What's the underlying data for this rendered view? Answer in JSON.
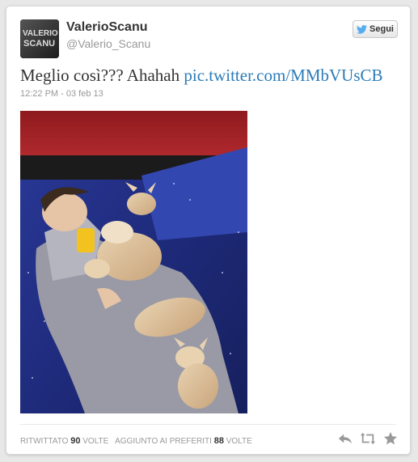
{
  "tweet": {
    "author_name": "ValerioScanu",
    "author_handle": "@Valerio_Scanu",
    "avatar_text_top": "VALERIO",
    "avatar_text_bottom": "SCANU",
    "text": "Meglio così??? Ahahah ",
    "link_text": "pic.twitter.com/MMbVUsCB",
    "timestamp": "12:22 PM - 03 feb 13"
  },
  "follow_button": {
    "label": "Segui",
    "icon": "twitter-bird-icon"
  },
  "stats": {
    "retweet_prefix": "Ritwittato",
    "retweet_count": "90",
    "retweet_suffix": "volte",
    "fav_prefix": "aggiunto ai preferiti",
    "fav_count": "88",
    "fav_suffix": "volte"
  },
  "actions": [
    {
      "name": "reply-icon"
    },
    {
      "name": "retweet-icon"
    },
    {
      "name": "favorite-star-icon"
    }
  ],
  "colors": {
    "link": "#2b7bb9",
    "twitter_blue": "#55acee",
    "muted": "#999999"
  }
}
